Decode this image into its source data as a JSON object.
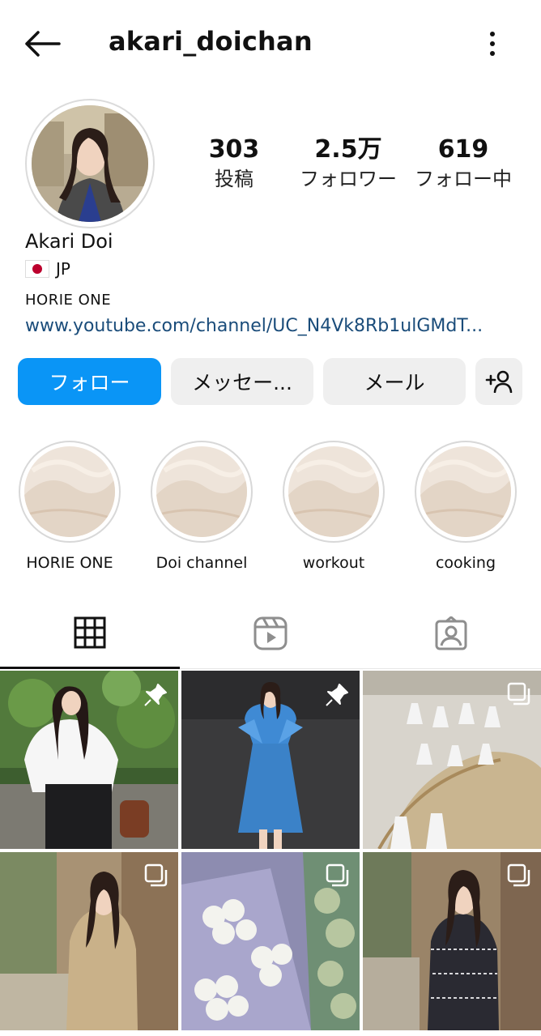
{
  "header": {
    "username": "akari_doichan",
    "back_icon": "arrow-left-icon",
    "more_icon": "more-vertical-icon"
  },
  "profile": {
    "display_name": "Akari Doi",
    "country_flag": "japan-flag-icon",
    "country": "JP",
    "category": "HORIE ONE",
    "link": "www.youtube.com/channel/UC_N4Vk8Rb1ulGMdT..."
  },
  "stats": [
    {
      "value": "303",
      "label": "投稿"
    },
    {
      "value": "2.5万",
      "label": "フォロワー"
    },
    {
      "value": "619",
      "label": "フォロー中"
    }
  ],
  "actions": {
    "follow": "フォロー",
    "message": "メッセー...",
    "mail": "メール",
    "add_user_icon": "add-user-icon"
  },
  "highlights": [
    {
      "label": "HORIE ONE"
    },
    {
      "label": "Doi channel"
    },
    {
      "label": "workout"
    },
    {
      "label": "cooking"
    }
  ],
  "tabs": [
    {
      "icon": "grid-icon",
      "active": true
    },
    {
      "icon": "reels-icon",
      "active": false
    },
    {
      "icon": "tagged-icon",
      "active": false
    }
  ],
  "grid": [
    {
      "badge": "pin-icon"
    },
    {
      "badge": "pin-icon"
    },
    {
      "badge": "carousel-icon"
    },
    {
      "badge": "carousel-icon"
    },
    {
      "badge": "carousel-icon"
    },
    {
      "badge": "carousel-icon"
    }
  ],
  "colors": {
    "accent": "#0a95f6",
    "link": "#1a4c7a",
    "button_bg": "#efefef"
  }
}
